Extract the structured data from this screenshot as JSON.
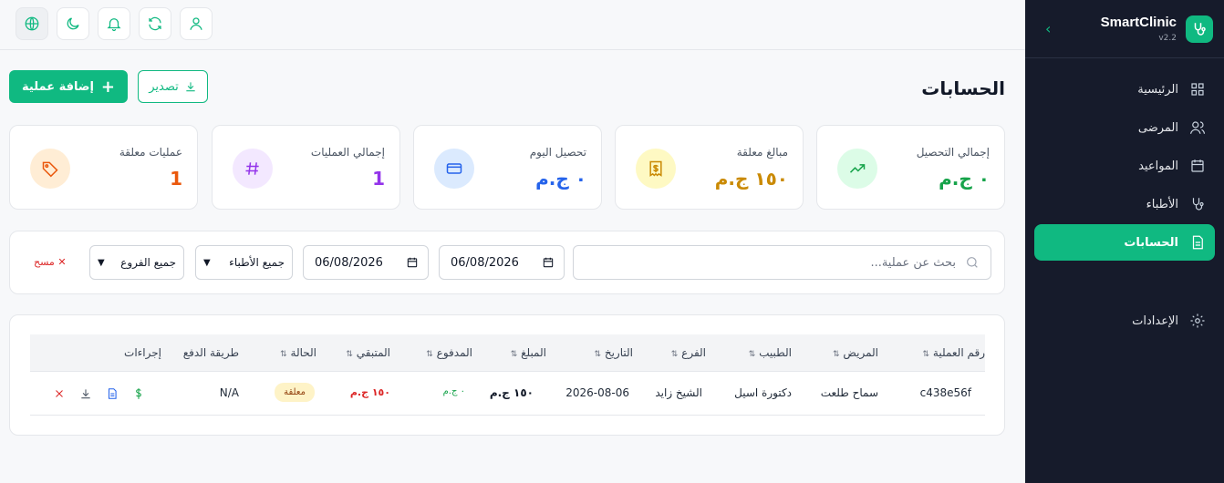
{
  "brand": {
    "name": "SmartClinic",
    "version": "v2.2"
  },
  "sidebar": {
    "items": [
      {
        "label": "الرئيسية",
        "icon": "dashboard-icon"
      },
      {
        "label": "المرضى",
        "icon": "users-icon"
      },
      {
        "label": "المواعيد",
        "icon": "calendar-icon"
      },
      {
        "label": "الأطباء",
        "icon": "stethoscope-icon"
      },
      {
        "label": "الحسابات",
        "icon": "document-icon",
        "active": true
      },
      {
        "label": "الإعدادات",
        "icon": "gear-icon"
      }
    ]
  },
  "page": {
    "title": "الحسابات"
  },
  "actions": {
    "add_label": "إضافة عملية",
    "export_label": "تصدير"
  },
  "stats": [
    {
      "label": "إجمالي التحصيل",
      "value": "٠ ج.م",
      "color": "#16a34a",
      "icon": "trending-up-icon"
    },
    {
      "label": "مبالغ معلقة",
      "value": "١٥٠ ج.م",
      "color": "#ca8a04",
      "icon": "receipt-icon"
    },
    {
      "label": "تحصيل اليوم",
      "value": "٠ ج.م",
      "color": "#2563eb",
      "icon": "credit-card-icon"
    },
    {
      "label": "إجمالي العمليات",
      "value": "1",
      "color": "#9333ea",
      "icon": "hash-icon"
    },
    {
      "label": "عمليات معلقة",
      "value": "1",
      "color": "#ea580c",
      "icon": "tag-icon"
    }
  ],
  "filters": {
    "search_placeholder": "بحث عن عملية...",
    "date_from": "06/08/2026",
    "date_to": "06/08/2026",
    "doctor": "جميع الأطباء",
    "branch": "جميع الفروع",
    "clear_label": "مسح"
  },
  "table": {
    "headers": [
      "رقم العملية",
      "المريض",
      "الطبيب",
      "الفرع",
      "التاريخ",
      "المبلغ",
      "المدفوع",
      "المتبقي",
      "الحالة",
      "طريقة الدفع",
      "إجراءات"
    ],
    "rows": [
      {
        "id": "c438e56f",
        "patient": "سماح طلعت",
        "doctor": "دكتورة اسيل",
        "branch": "الشيخ زايد",
        "date": "2026-08-06",
        "amount": "١٥٠ ج.م",
        "paid": "٠ ج.م",
        "remaining": "١٥٠ ج.م",
        "status": "معلقة",
        "method": "N/A"
      }
    ]
  },
  "colors": {
    "accent": "#10b981",
    "sidebar_bg": "#161b2b",
    "danger": "#dc2626"
  }
}
